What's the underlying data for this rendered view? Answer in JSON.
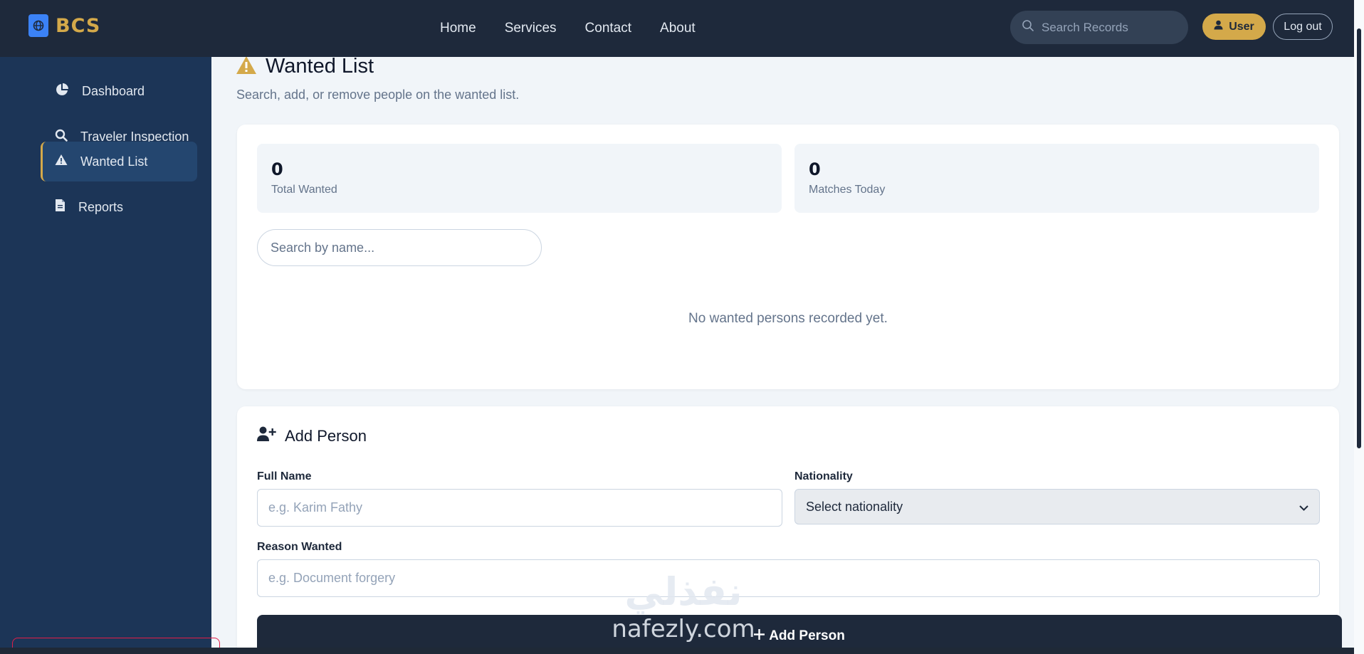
{
  "header": {
    "brand": "BCS",
    "nav": [
      "Home",
      "Services",
      "Contact",
      "About"
    ],
    "search_placeholder": "Search Records",
    "user_label": "User",
    "logout_label": "Log out"
  },
  "sidebar": {
    "items": [
      {
        "label": "Dashboard",
        "icon": "pie-chart-icon"
      },
      {
        "label": "Traveler Inspection",
        "icon": "search-icon"
      },
      {
        "label": "Wanted List",
        "icon": "warning-icon",
        "active": true
      },
      {
        "label": "Reports",
        "icon": "file-icon"
      }
    ]
  },
  "page": {
    "title": "Wanted List",
    "subtitle": "Search, add, or remove people on the wanted list."
  },
  "stats": {
    "total_value": "0",
    "total_label": "Total Wanted",
    "matches_value": "0",
    "matches_label": "Matches Today"
  },
  "list": {
    "search_placeholder": "Search by name...",
    "empty_message": "No wanted persons recorded yet."
  },
  "form": {
    "title": "Add Person",
    "full_name_label": "Full Name",
    "full_name_placeholder": "e.g. Karim Fathy",
    "nationality_label": "Nationality",
    "nationality_selected": "Select nationality",
    "reason_label": "Reason Wanted",
    "reason_placeholder": "e.g. Document forgery",
    "submit_label": "Add Person"
  },
  "watermark": {
    "arabic": "نفذلي",
    "latin": "nafezly.com"
  },
  "colors": {
    "navbar": "#1e293b",
    "sidebar": "#1c3557",
    "accent_gold": "#d4a94a",
    "page_bg": "#f1f5f9"
  }
}
